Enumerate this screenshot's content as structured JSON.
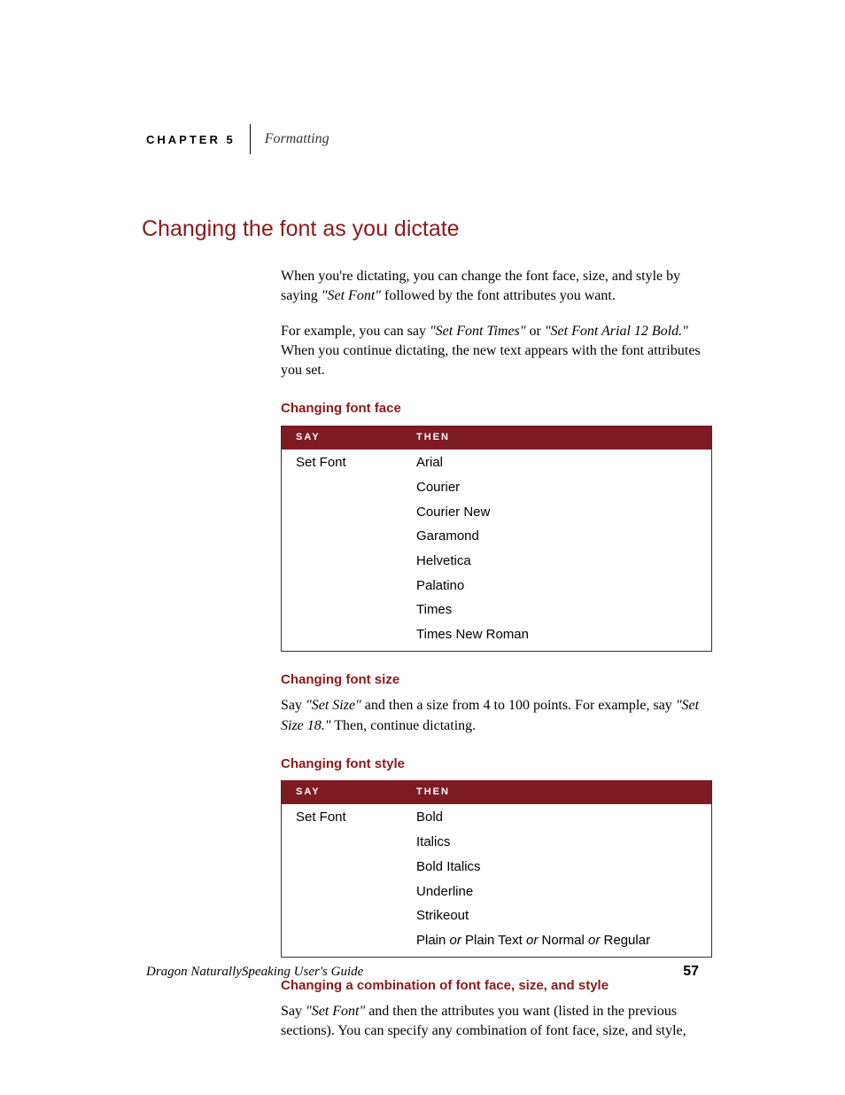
{
  "chapter_label": "CHAPTER 5",
  "chapter_title": "Formatting",
  "h1": "Changing the font as you dictate",
  "intro": {
    "p1a": "When you're dictating, you can change the font face, size, and style by saying ",
    "p1q": "\"Set Font\"",
    "p1b": " followed by the font attributes you want.",
    "p2a": "For example, you can say ",
    "p2q1": "\"Set Font Times\"",
    "p2mid": " or ",
    "p2q2": "\"Set Font Arial 12 Bold.\"",
    "p2b": " When you continue dictating, the new text appears with the font attributes you set."
  },
  "sub_face": "Changing font face",
  "table_face": {
    "h1": "Say",
    "h2": "Then",
    "say": "Set Font",
    "then": [
      "Arial",
      "Courier",
      "Courier New",
      "Garamond",
      "Helvetica",
      "Palatino",
      "Times",
      "Times New Roman"
    ]
  },
  "sub_size": "Changing font size",
  "size_para_a": "Say ",
  "size_q1": "\"Set Size\"",
  "size_para_b": " and then a size from 4 to 100 points. For example, say ",
  "size_q2": "\"Set Size 18.\"",
  "size_para_c": " Then, continue dictating.",
  "sub_style": "Changing font style",
  "table_style": {
    "h1": "Say",
    "h2": "Then",
    "say": "Set Font",
    "then": [
      "Bold",
      "Italics",
      "Bold Italics",
      "Underline",
      "Strikeout"
    ],
    "last_parts": [
      "Plain",
      "Plain Text",
      "Normal",
      "Regular"
    ],
    "or": " or "
  },
  "sub_combo": "Changing a combination of font face, size, and style",
  "combo_a": "Say ",
  "combo_q": "\"Set Font\"",
  "combo_b": " and then the attributes you want (listed in the previous sections). You can specify any combination of font face, size, and style,",
  "footer_title": "Dragon NaturallySpeaking User's Guide",
  "page_number": "57"
}
